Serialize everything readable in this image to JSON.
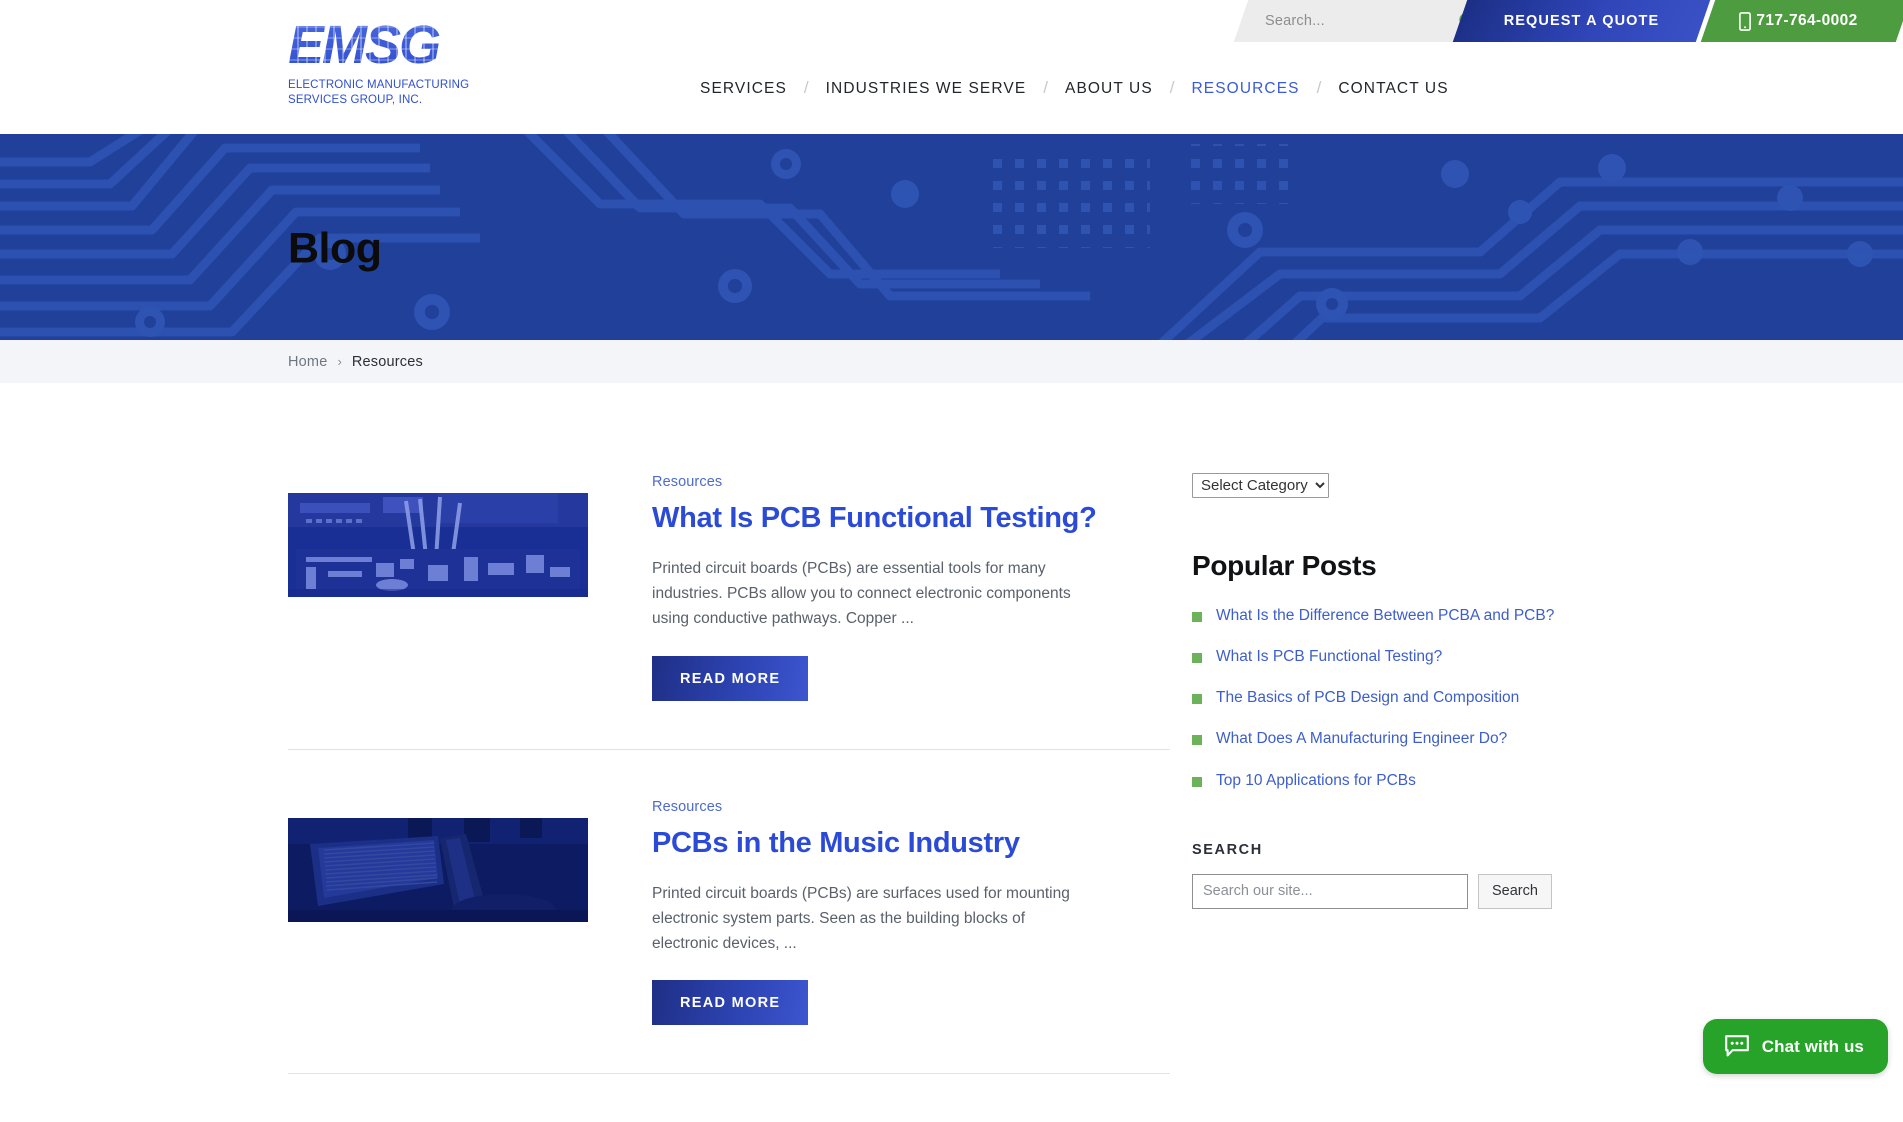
{
  "topbar": {
    "search_placeholder": "Search...",
    "search_value": "",
    "search_icon": "search-icon",
    "quote_label": "REQUEST A QUOTE",
    "phone_label": "717-764-0002",
    "phone_icon": "mobile-phone-icon"
  },
  "brand": {
    "logo_text": "EMSG",
    "logo_subtitle": "ELECTRONIC MANUFACTURING SERVICES GROUP, INC."
  },
  "nav": {
    "separator": "/",
    "items": [
      {
        "label": "SERVICES",
        "active": false
      },
      {
        "label": "INDUSTRIES WE SERVE",
        "active": false
      },
      {
        "label": "ABOUT US",
        "active": false
      },
      {
        "label": "RESOURCES",
        "active": true
      },
      {
        "label": "CONTACT US",
        "active": false
      }
    ]
  },
  "hero": {
    "title": "Blog"
  },
  "breadcrumb": {
    "home": "Home",
    "separator": "›",
    "current": "Resources"
  },
  "posts": [
    {
      "category": "Resources",
      "title": "What Is PCB Functional Testing?",
      "excerpt": "Printed circuit boards (PCBs) are essential tools for many industries. PCBs allow you to connect electronic components using conductive pathways. Copper ...",
      "button_label": "READ MORE",
      "thumb_name": "pcb-assembly-machine-photo"
    },
    {
      "category": "Resources",
      "title": "PCBs in the Music Industry",
      "excerpt": "Printed circuit boards (PCBs) are surfaces used for mounting electronic system parts. Seen as the building blocks of electronic devices, ...",
      "button_label": "READ MORE",
      "thumb_name": "music-equipment-photo"
    }
  ],
  "sidebar": {
    "category_select": {
      "selected": "Select Category",
      "options": [
        "Select Category"
      ]
    },
    "popular": {
      "title": "Popular Posts",
      "items": [
        "What Is the Difference Between PCBA and PCB?",
        "What Is PCB Functional Testing?",
        "The Basics of PCB Design and Composition",
        "What Does A Manufacturing Engineer Do?",
        "Top 10 Applications for PCBs"
      ]
    },
    "search": {
      "title": "SEARCH",
      "placeholder": "Search our site...",
      "value": "",
      "button_label": "Search"
    }
  },
  "chat": {
    "label": "Chat with us",
    "icon": "chat-bubble-icon"
  },
  "colors": {
    "brand_blue": "#2f4fd0",
    "hero_blue": "#21409a",
    "accent_green": "#4d9c3f",
    "link_blue": "#2b4bd6",
    "bullet_green": "#6cb25b",
    "chat_green": "#27a329"
  }
}
